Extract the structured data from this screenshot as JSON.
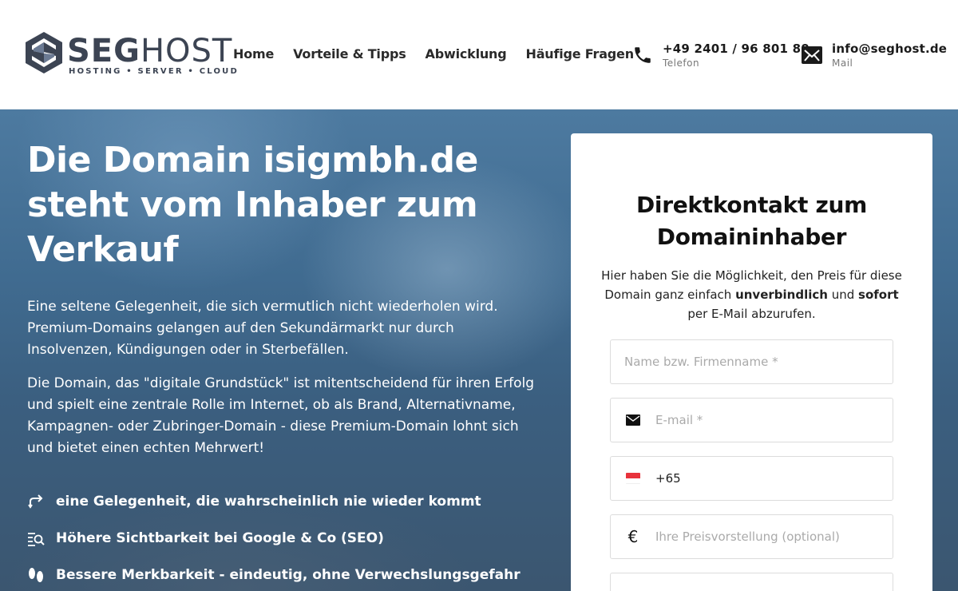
{
  "brand": {
    "name_bold": "SEG",
    "name_light": "HOST",
    "tagline": "HOSTING • SERVER • CLOUD"
  },
  "nav": {
    "items": [
      {
        "label": "Home"
      },
      {
        "label": "Vorteile & Tipps"
      },
      {
        "label": "Abwicklung"
      },
      {
        "label": "Häufige Fragen"
      }
    ]
  },
  "contact": {
    "phone": {
      "value": "+49 2401 / 96 801 80",
      "label": "Telefon",
      "icon": "phone-icon"
    },
    "mail": {
      "value": "info@seghost.de",
      "label": "Mail",
      "icon": "mail-icon"
    }
  },
  "hero": {
    "title": "Die Domain isigmbh.de steht vom Inhaber zum Verkauf",
    "paragraph1": "Eine seltene Gelegenheit, die sich vermutlich nicht wiederholen wird. Premium-Domains gelangen auf den Sekundärmarkt nur durch Insolvenzen, Kündigungen oder in Sterbefällen.",
    "paragraph2": "Die Domain, das \"digitale Grundstück\" ist mitentscheidend für ihren Erfolg und spielt eine zentrale Rolle im Internet, ob als Brand, Alternativname, Kampagnen- oder Zubringer-Domain - diese Premium-Domain lohnt sich und bietet einen echten Mehrwert!",
    "features": [
      {
        "label": "eine Gelegenheit, die wahrscheinlich nie wieder kommt",
        "icon": "arrows-icon"
      },
      {
        "label": "Höhere Sichtbarkeit bei Google & Co (SEO)",
        "icon": "search-list-icon"
      },
      {
        "label": "Bessere Merkbarkeit - eindeutig, ohne Verwechslungsgefahr",
        "icon": "footprints-icon"
      }
    ]
  },
  "form": {
    "title": "Direktkontakt zum Domaininhaber",
    "intro_pre": "Hier haben Sie die Möglichkeit, den Preis für diese Domain ganz einfach ",
    "intro_bold1": "unverbindlich",
    "intro_mid": " und ",
    "intro_bold2": "sofort",
    "intro_post": " per E-Mail abzurufen.",
    "name_placeholder": "Name bzw. Firmenname *",
    "email_placeholder": "E-mail *",
    "phone_value": "+65",
    "price_placeholder": "Ihre Preisvorstellung (optional)",
    "currency_symbol": "€"
  },
  "colors": {
    "logo_dark": "#3c4453",
    "hero_blue": "#406b90"
  }
}
